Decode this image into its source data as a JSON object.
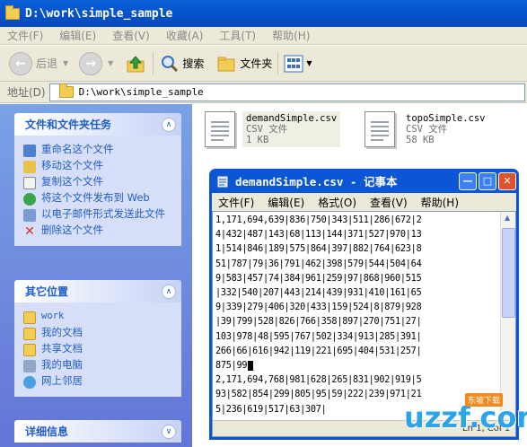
{
  "window": {
    "title": "D:\\work\\simple_sample"
  },
  "menubar": [
    "文件(F)",
    "编辑(E)",
    "查看(V)",
    "收藏(A)",
    "工具(T)",
    "帮助(H)"
  ],
  "toolbar": {
    "back": "后退",
    "search": "搜索",
    "folders": "文件夹"
  },
  "address": {
    "label": "地址(D)",
    "value": "D:\\work\\simple_sample"
  },
  "sidebar": {
    "tasks": {
      "title": "文件和文件夹任务",
      "items": [
        "重命名这个文件",
        "移动这个文件",
        "复制这个文件",
        "将这个文件发布到 Web",
        "以电子邮件形式发送此文件",
        "删除这个文件"
      ]
    },
    "places": {
      "title": "其它位置",
      "items": [
        "work",
        "我的文档",
        "共享文档",
        "我的电脑",
        "网上邻居"
      ]
    },
    "details": {
      "title": "详细信息"
    }
  },
  "files": [
    {
      "name": "demandSimple.csv",
      "type": "CSV 文件",
      "size": "1 KB"
    },
    {
      "name": "topoSimple.csv",
      "type": "CSV 文件",
      "size": "58 KB"
    }
  ],
  "notepad": {
    "title": "demandSimple.csv - 记事本",
    "menu": [
      "文件(F)",
      "编辑(E)",
      "格式(O)",
      "查看(V)",
      "帮助(H)"
    ],
    "lines": [
      "1,171,694,639|836|750|343|511|286|672|2",
      "4|432|487|143|68|113|144|371|527|970|13",
      "1|514|846|189|575|864|397|882|764|623|8",
      "51|787|79|36|791|462|398|579|544|504|64",
      "9|583|457|74|384|961|259|97|868|960|515",
      "|332|540|207|443|214|439|931|410|161|65",
      "9|339|279|406|320|433|159|524|8|879|928",
      "|39|799|528|826|766|358|897|270|751|27|",
      "103|978|48|595|767|502|334|913|285|391|",
      "266|66|616|942|119|221|695|404|531|257|",
      "875|99",
      "2,171,694,768|981|628|265|831|902|919|5",
      "93|582|854|299|805|95|59|222|239|971|21",
      "5|236|619|517|63|307|"
    ],
    "status": "Ln 1, Col 1"
  },
  "watermark": {
    "logo": "uzzf.com",
    "tag": "东坡下载"
  }
}
